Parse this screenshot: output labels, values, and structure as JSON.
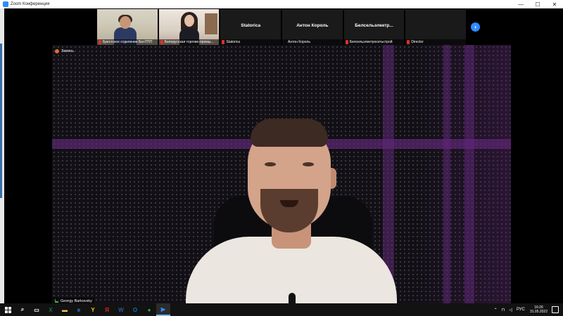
{
  "window": {
    "title": "Zoom Конференция",
    "min": "—",
    "max": "☐",
    "close": "✕"
  },
  "thumbnails": [
    {
      "name": "",
      "label": "Брестское отделение БелТПП",
      "has_video": true,
      "muted": true
    },
    {
      "name": "",
      "label": "Белорусская торгово-промы...",
      "has_video": true,
      "muted": true
    },
    {
      "name": "Statorica",
      "label": "Statorica",
      "has_video": false,
      "muted": true
    },
    {
      "name": "Антон Король",
      "label": "Антон Король",
      "has_video": false,
      "muted": false
    },
    {
      "name": "Белсельэлектр...",
      "label": "Белсельэлектросетьстрой",
      "has_video": false,
      "muted": true
    },
    {
      "name": "",
      "label": "Director",
      "has_video": false,
      "muted": true
    }
  ],
  "next_page_icon": "chevron-right-icon",
  "active_view": {
    "label": "Запись",
    "speaker_name": "Georgy Barkovsky"
  },
  "taskbar": {
    "apps": [
      {
        "name": "search-icon",
        "glyph": "⌕",
        "color": "#ffffff"
      },
      {
        "name": "task-view-icon",
        "glyph": "▭",
        "color": "#ffffff"
      },
      {
        "name": "excel-icon",
        "glyph": "X",
        "color": "#1d7044"
      },
      {
        "name": "file-explorer-icon",
        "glyph": "▬",
        "color": "#f2c94c"
      },
      {
        "name": "edge-icon",
        "glyph": "e",
        "color": "#2f7ed8"
      },
      {
        "name": "yandex-browser-icon",
        "glyph": "Y",
        "color": "#ffcc00"
      },
      {
        "name": "yandex-icon",
        "glyph": "Я",
        "color": "#e52620"
      },
      {
        "name": "word-icon",
        "glyph": "W",
        "color": "#2b579a"
      },
      {
        "name": "outlook-icon",
        "glyph": "O",
        "color": "#0f6cbd"
      },
      {
        "name": "chrome-icon",
        "glyph": "●",
        "color": "#34a853"
      },
      {
        "name": "zoom-icon",
        "glyph": "▶",
        "color": "#2d8cff"
      }
    ],
    "language": "РУС",
    "time": "16:26",
    "date": "31.05.2022"
  }
}
